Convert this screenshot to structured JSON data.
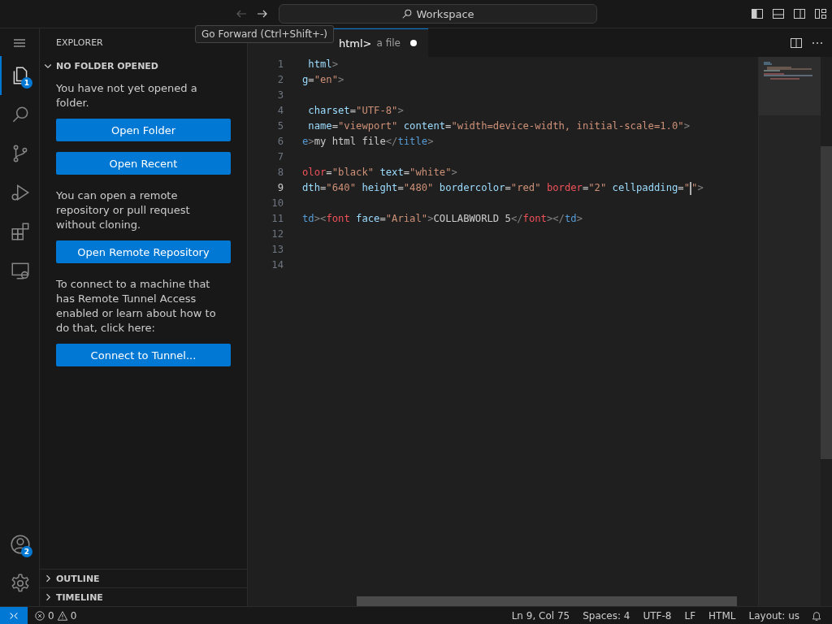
{
  "title_bar": {
    "nav": [
      {
        "kind": "back",
        "disabled": true
      },
      {
        "kind": "forward",
        "disabled": false
      }
    ],
    "search": "Workspace",
    "layout_toggles": [
      {
        "kind": "sidebar",
        "on": true
      },
      {
        "kind": "panel",
        "on": false
      },
      {
        "kind": "secondary",
        "on": false
      },
      {
        "kind": "customize",
        "on": false
      }
    ]
  },
  "tooltip": "Go Forward (Ctrl+Shift+-)",
  "activity_bar": {
    "top": [
      {
        "kind": "explorer",
        "selected": true,
        "badge": "1"
      },
      {
        "kind": "search",
        "selected": false
      },
      {
        "kind": "source_control",
        "selected": false
      },
      {
        "kind": "run",
        "selected": false
      },
      {
        "kind": "extensions",
        "selected": false
      },
      {
        "kind": "remote",
        "selected": false
      }
    ],
    "bottom": [
      {
        "kind": "accounts",
        "selected": false,
        "badge": "2"
      },
      {
        "kind": "settings",
        "selected": false
      }
    ]
  },
  "sidebar": {
    "title": "EXPLORER",
    "section": {
      "label": "NO FOLDER OPENED",
      "expanded": true
    },
    "content": [
      {
        "kind": "text",
        "text": "You have not yet opened a folder."
      },
      {
        "kind": "button",
        "text": "Open Folder"
      },
      {
        "kind": "button",
        "text": "Open Recent"
      },
      {
        "kind": "text",
        "text": "You can open a remote repository or pull request without cloning."
      },
      {
        "kind": "button",
        "text": "Open Remote Repository"
      },
      {
        "kind": "text",
        "text": "To connect to a machine that has Remote Tunnel Access enabled or learn about how to do that, click here:"
      },
      {
        "kind": "button",
        "text": "Connect to Tunnel..."
      }
    ],
    "panels": [
      {
        "label": "OUTLINE",
        "expanded": false
      },
      {
        "label": "TIMELINE",
        "expanded": false
      }
    ]
  },
  "editor": {
    "tab": {
      "name": "html>",
      "description": "a file",
      "dirty": true
    },
    "lines": [
      {
        "number": "1",
        "active": false,
        "tokens": [
          {
            "kind": "attr",
            "text": " html"
          },
          {
            "kind": "punct",
            "text": ">"
          }
        ]
      },
      {
        "number": "2",
        "active": false,
        "tokens": [
          {
            "kind": "attr",
            "text": "g"
          },
          {
            "kind": "text",
            "text": "="
          },
          {
            "kind": "str",
            "text": "\"en\""
          },
          {
            "kind": "punct",
            "text": ">"
          }
        ]
      },
      {
        "number": "3",
        "active": false
      },
      {
        "number": "4",
        "active": false,
        "tokens": [
          {
            "kind": "attr",
            "text": " charset"
          },
          {
            "kind": "text",
            "text": "="
          },
          {
            "kind": "str",
            "text": "\"UTF-8\""
          },
          {
            "kind": "punct",
            "text": ">"
          }
        ]
      },
      {
        "number": "5",
        "active": false,
        "tokens": [
          {
            "kind": "attr",
            "text": " name"
          },
          {
            "kind": "text",
            "text": "="
          },
          {
            "kind": "str",
            "text": "\"viewport\""
          },
          {
            "kind": "attr",
            "text": " content"
          },
          {
            "kind": "text",
            "text": "="
          },
          {
            "kind": "str",
            "text": "\"width=device-width, initial-scale=1.0\""
          },
          {
            "kind": "punct",
            "text": ">"
          }
        ]
      },
      {
        "number": "6",
        "active": false,
        "tokens": [
          {
            "kind": "tag",
            "text": "e"
          },
          {
            "kind": "punct",
            "text": ">"
          },
          {
            "kind": "text",
            "text": "my html file"
          },
          {
            "kind": "punct",
            "text": "</"
          },
          {
            "kind": "tag",
            "text": "title"
          },
          {
            "kind": "punct",
            "text": ">"
          }
        ]
      },
      {
        "number": "7",
        "active": false
      },
      {
        "number": "8",
        "active": false,
        "tokens": [
          {
            "kind": "deprecated",
            "text": "olor"
          },
          {
            "kind": "text",
            "text": "="
          },
          {
            "kind": "str",
            "text": "\"black\""
          },
          {
            "kind": "attr",
            "text": " text"
          },
          {
            "kind": "text",
            "text": "="
          },
          {
            "kind": "str",
            "text": "\"white\""
          },
          {
            "kind": "punct",
            "text": ">"
          }
        ]
      },
      {
        "number": "9",
        "active": true,
        "tokens": [
          {
            "kind": "attr",
            "text": "dth"
          },
          {
            "kind": "text",
            "text": "="
          },
          {
            "kind": "str",
            "text": "\"640\""
          },
          {
            "kind": "attr",
            "text": " height"
          },
          {
            "kind": "text",
            "text": "="
          },
          {
            "kind": "str",
            "text": "\"480\""
          },
          {
            "kind": "attr",
            "text": " bordercolor"
          },
          {
            "kind": "text",
            "text": "="
          },
          {
            "kind": "str",
            "text": "\"red\""
          },
          {
            "kind": "deprecated",
            "text": " border"
          },
          {
            "kind": "text",
            "text": "="
          },
          {
            "kind": "str",
            "text": "\"2\""
          },
          {
            "kind": "attr",
            "text": " cellpadding"
          },
          {
            "kind": "text",
            "text": "="
          },
          {
            "kind": "str",
            "text": "\""
          },
          {
            "kind": "cursor"
          },
          {
            "kind": "str",
            "text": "\""
          },
          {
            "kind": "punct",
            "text": ">"
          }
        ]
      },
      {
        "number": "10",
        "active": false
      },
      {
        "number": "11",
        "active": false,
        "tokens": [
          {
            "kind": "tag",
            "text": "td"
          },
          {
            "kind": "punct",
            "text": "><"
          },
          {
            "kind": "deprecated",
            "text": "font"
          },
          {
            "kind": "attr",
            "text": " face"
          },
          {
            "kind": "text",
            "text": "="
          },
          {
            "kind": "str",
            "text": "\"Arial\""
          },
          {
            "kind": "punct",
            "text": ">"
          },
          {
            "kind": "text",
            "text": "COLLABWORLD 5"
          },
          {
            "kind": "punct",
            "text": "</"
          },
          {
            "kind": "deprecated",
            "text": "font"
          },
          {
            "kind": "punct",
            "text": "></"
          },
          {
            "kind": "tag",
            "text": "td"
          },
          {
            "kind": "punct",
            "text": ">"
          }
        ]
      },
      {
        "number": "12",
        "active": false
      },
      {
        "number": "13",
        "active": false
      },
      {
        "number": "14",
        "active": false
      }
    ]
  },
  "status_bar": {
    "errors": "0",
    "warnings": "0",
    "items": [
      "Ln 9, Col 75",
      "Spaces: 4",
      "UTF-8",
      "LF",
      "HTML",
      "Layout: us"
    ]
  }
}
